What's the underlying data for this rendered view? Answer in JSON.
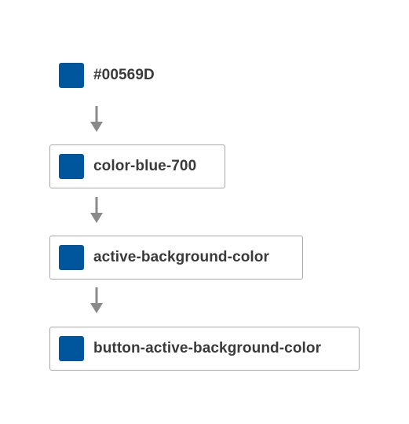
{
  "colors": {
    "swatch": "#00569D",
    "arrow": "#8a8a8a",
    "border": "#a8a8a8",
    "text": "#3a3a3a"
  },
  "nodes": [
    {
      "label": "#00569D",
      "icon": "color-swatch-icon"
    },
    {
      "label": "color-blue-700",
      "icon": "color-swatch-icon"
    },
    {
      "label": "active-background-color",
      "icon": "color-swatch-icon"
    },
    {
      "label": "button-active-background-color",
      "icon": "color-swatch-icon"
    }
  ],
  "arrows": [
    {
      "icon": "arrow-down-icon"
    },
    {
      "icon": "arrow-down-icon"
    },
    {
      "icon": "arrow-down-icon"
    }
  ]
}
